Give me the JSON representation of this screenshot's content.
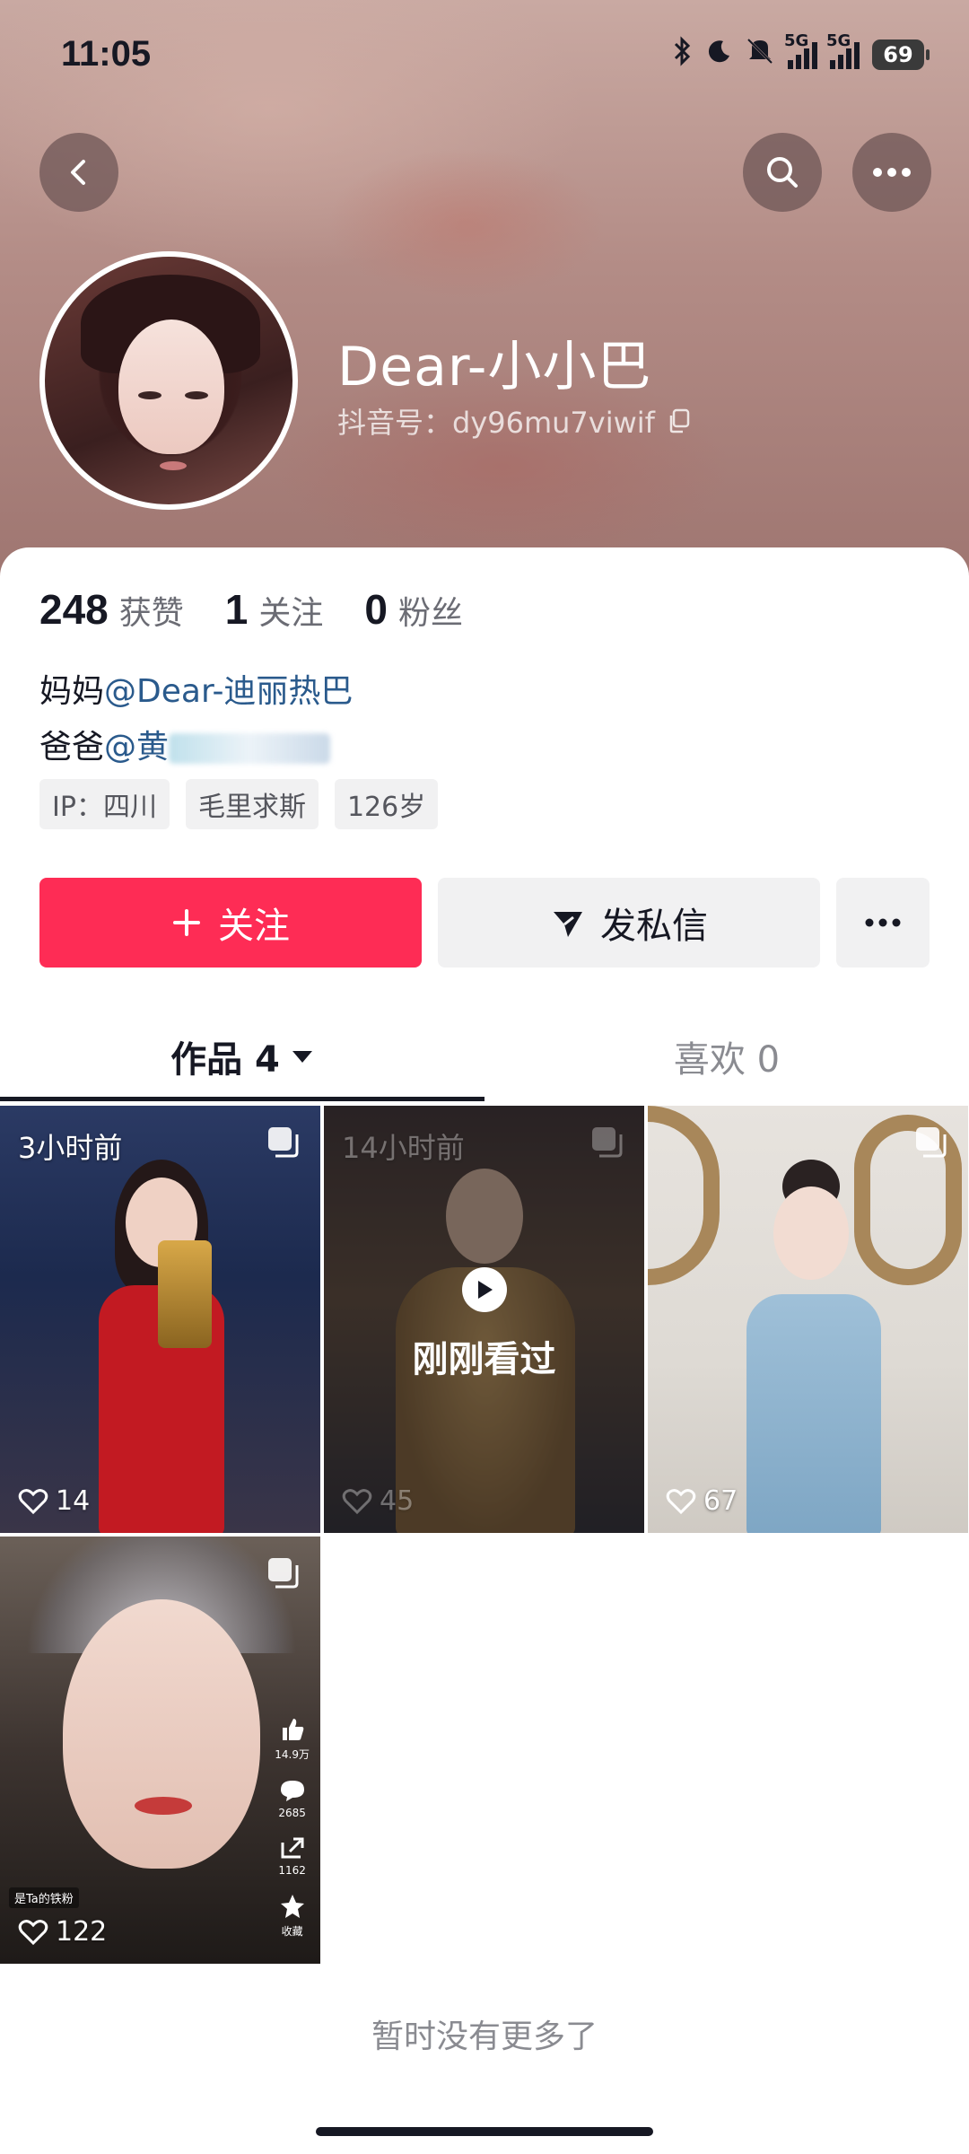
{
  "status_bar": {
    "time": "11:05",
    "signal_label_1": "5G",
    "signal_label_2": "5G",
    "battery": "69"
  },
  "header": {
    "display_name": "Dear-小小巴",
    "douyin_id": "抖音号：dy96mu7viwif"
  },
  "stats": [
    {
      "value": "248",
      "label": "获赞"
    },
    {
      "value": "1",
      "label": "关注"
    },
    {
      "value": "0",
      "label": "粉丝"
    }
  ],
  "bio": {
    "line1_prefix": "妈妈",
    "line1_mention": "@Dear-迪丽热巴",
    "line2_prefix": "爸爸",
    "line2_mention": "@黄"
  },
  "tags": [
    "IP：四川",
    "毛里求斯",
    "126岁"
  ],
  "actions": {
    "follow_label": "关注",
    "message_label": "发私信"
  },
  "tabs": [
    {
      "label": "作品 4",
      "active": true
    },
    {
      "label": "喜欢 0",
      "active": false
    }
  ],
  "posts": [
    {
      "time": "3小时前",
      "likes": "14"
    },
    {
      "time": "14小时前",
      "likes": "45",
      "overlay_label": "刚刚看过"
    },
    {
      "time": "",
      "likes": "67"
    },
    {
      "time": "",
      "likes": "122",
      "chip": "是Ta的铁粉",
      "side_counts": [
        "14.9万",
        "2685",
        "1162",
        "收藏"
      ]
    }
  ],
  "footer": {
    "no_more": "暂时没有更多了"
  },
  "colors": {
    "accent": "#fe2c55",
    "mention": "#2a5a8c",
    "text_primary": "#161823",
    "text_secondary": "#8a8b91"
  }
}
